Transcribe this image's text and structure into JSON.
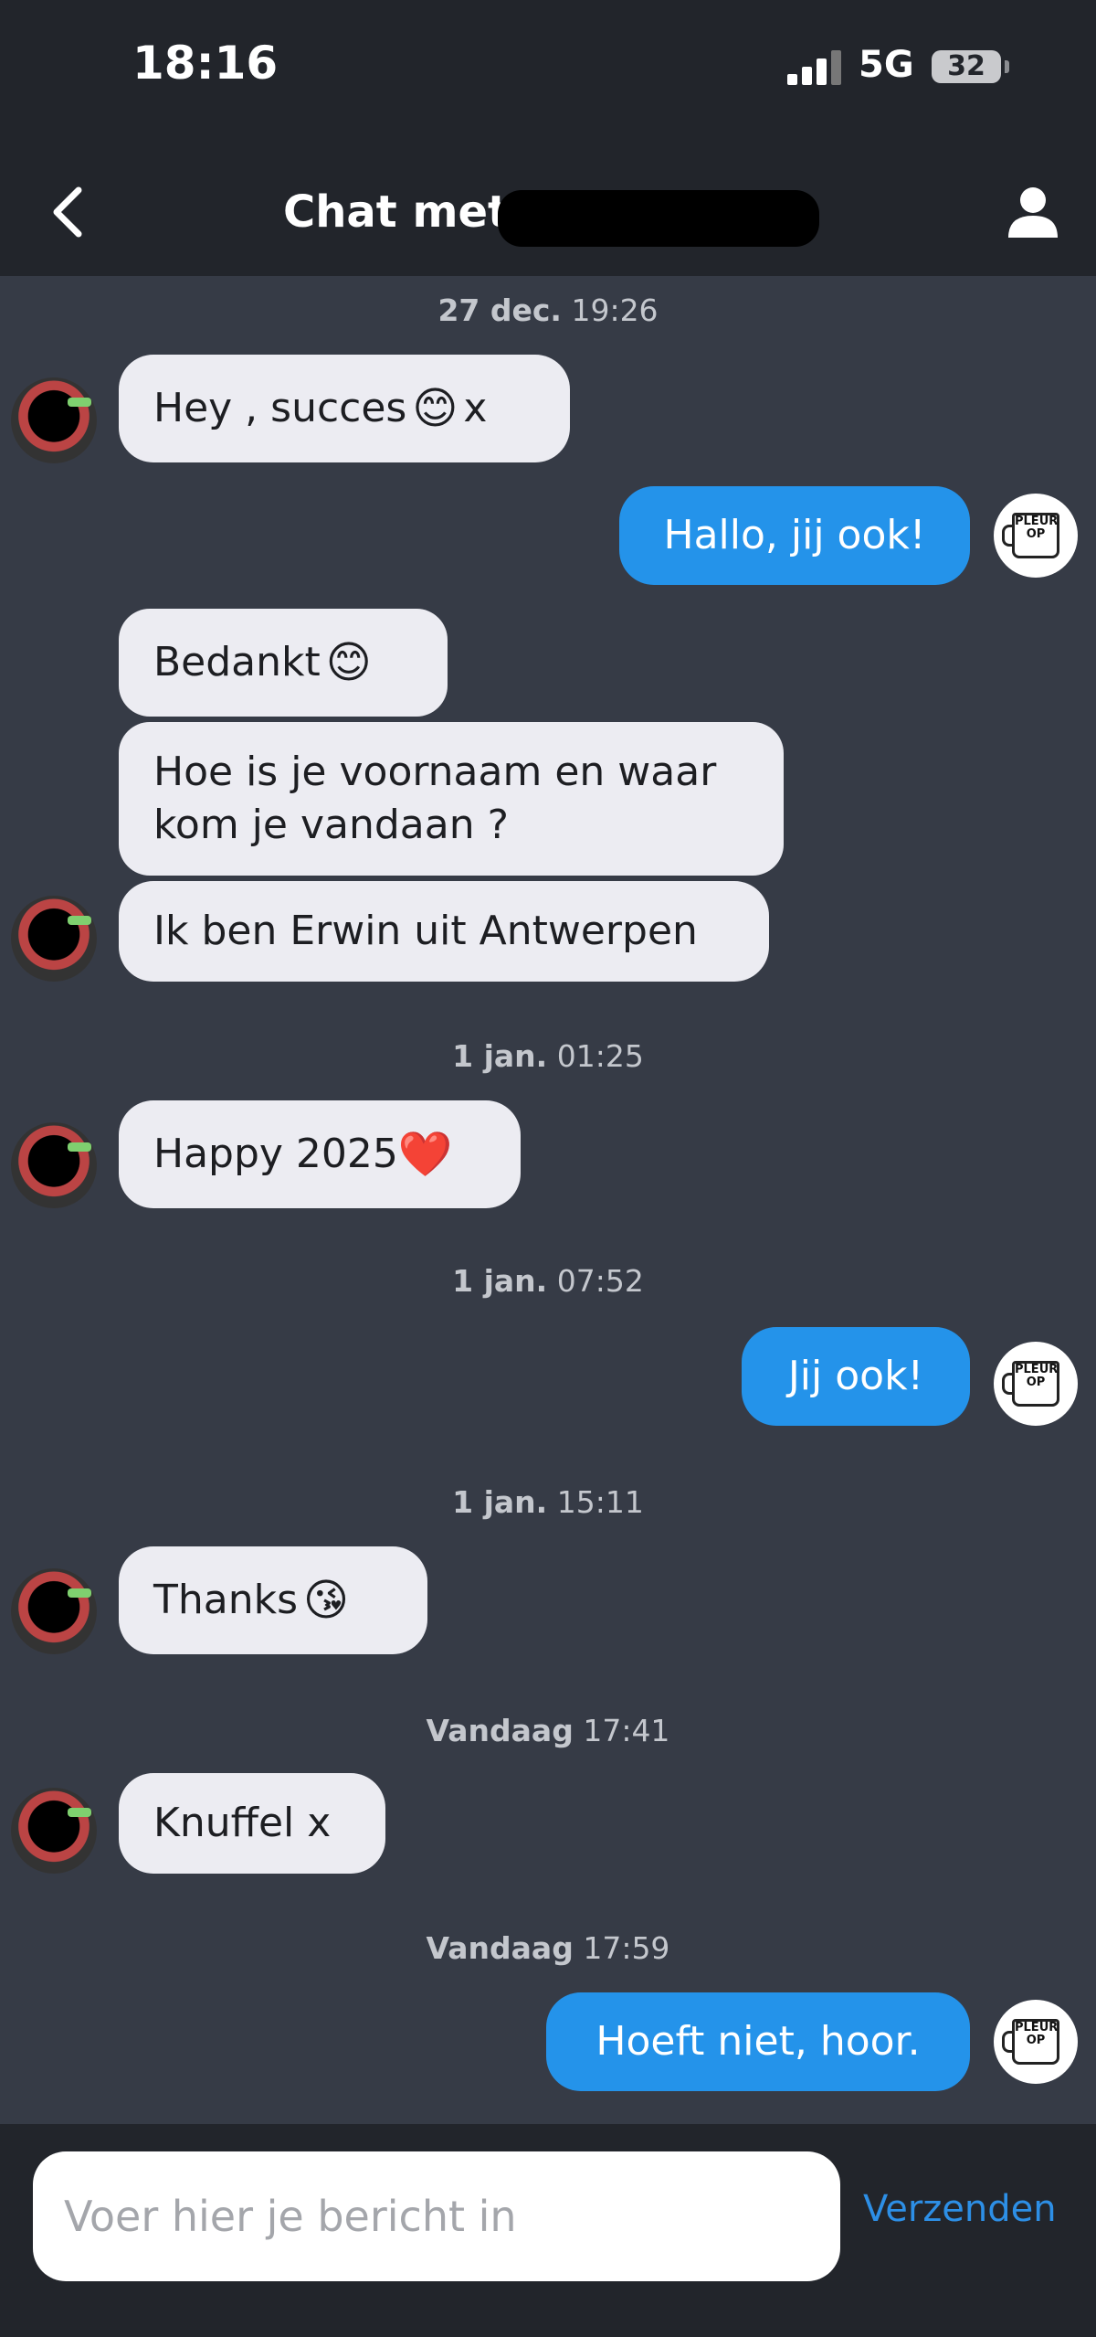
{
  "status_bar": {
    "time": "18:16",
    "network": "5G",
    "battery": "32"
  },
  "header": {
    "title": "Chat met"
  },
  "messages": {
    "ts1_date": "27 dec.",
    "ts1_time": "19:26",
    "m1": "Hey , succes",
    "m1_emoji": "😊",
    "m1_tail": "x",
    "m2": "Hallo, jij ook!",
    "m3": "Bedankt",
    "m3_emoji": "😊",
    "m4_line1": "Hoe is je voornaam en waar",
    "m4_line2": "kom je vandaan ?",
    "m5": "Ik ben Erwin uit Antwerpen",
    "ts2_date": "1 jan.",
    "ts2_time": "01:25",
    "m6": "Happy 2025",
    "m6_emoji": "❤️",
    "ts3_date": "1 jan.",
    "ts3_time": "07:52",
    "m7": "Jij ook!",
    "ts4_date": "1 jan.",
    "ts4_time": "15:11",
    "m8": "Thanks",
    "m8_emoji": "😘",
    "ts5_date": "Vandaag",
    "ts5_time": "17:41",
    "m9": "Knuffel x",
    "ts6_date": "Vandaag",
    "ts6_time": "17:59",
    "m10": "Hoeft niet, hoor."
  },
  "own_avatar_text": "PLEUR OP",
  "composer": {
    "placeholder": "Voer hier je bericht in",
    "send_label": "Verzenden"
  }
}
